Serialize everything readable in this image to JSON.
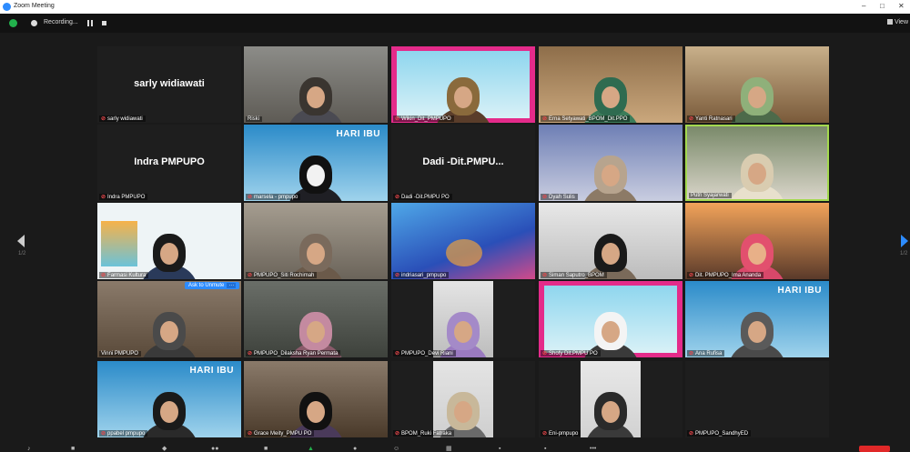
{
  "window": {
    "title": "Zoom Meeting",
    "minimize": "–",
    "restore": "□",
    "close": "✕"
  },
  "recording": {
    "label": "Recording...",
    "pause_icon": "pause-icon",
    "stop_icon": "stop-icon"
  },
  "view": {
    "label": "View"
  },
  "pager": {
    "left": "1/2",
    "right": "1/2"
  },
  "unmute_prompt": {
    "label": "Ask to Unmute",
    "more": "···"
  },
  "banners": {
    "hari_ibu": "HARI IBU"
  },
  "colors": {
    "accent": "#2d8cff",
    "mic_muted": "#e8474b",
    "active_speaker": "#a4d94f",
    "end_button": "#e02828"
  },
  "participants": [
    {
      "label": "sarly widiawati",
      "big_name": "sarly widiawati",
      "video": false
    },
    {
      "label": "Riski",
      "video": true
    },
    {
      "label": "Wikin_Dit_PMPUPO",
      "video": true
    },
    {
      "label": "Erna Setyawati_BPOM_Dit.PPO",
      "video": true
    },
    {
      "label": "Yanti Ratnasari",
      "video": true
    },
    {
      "label": "Indra PMPUPO",
      "big_name": "Indra PMPUPO",
      "video": false
    },
    {
      "label": "marsela - pmpupo",
      "video": true
    },
    {
      "label": "Dadi -Dit.PMPU PO",
      "big_name": "Dadi -Dit.PMPU...",
      "video": false
    },
    {
      "label": "Dyah Sulis",
      "video": true
    },
    {
      "label": "Putri Syajarwati",
      "video": true
    },
    {
      "label": "Farmasi Kultura",
      "video": true
    },
    {
      "label": "PMPUPO_Siti Rochimah",
      "video": true
    },
    {
      "label": "indriasari_pmpupo",
      "video": true
    },
    {
      "label": "Siman Saputro_BPOM",
      "video": true
    },
    {
      "label": "Dit. PMPUPO_Ima Ananda",
      "video": true
    },
    {
      "label": "Vinni PMPUPO",
      "video": true
    },
    {
      "label": "PMPUPO_Dilaksha Ryan Permata",
      "video": true
    },
    {
      "label": "PMPUPO_Devi Riani",
      "video": true
    },
    {
      "label": "Shofy Dit.PMPU PO",
      "video": true
    },
    {
      "label": "Ana Rufisa",
      "video": true
    },
    {
      "label": "ppabel pmpupo",
      "video": true
    },
    {
      "label": "Grace Meity_PMPU PO",
      "video": true
    },
    {
      "label": "BPOM_Ruki Fatraka",
      "video": true
    },
    {
      "label": "Eni-pmpupo",
      "video": true
    },
    {
      "label": "PMPUPO_SandhyED",
      "video": false
    }
  ]
}
